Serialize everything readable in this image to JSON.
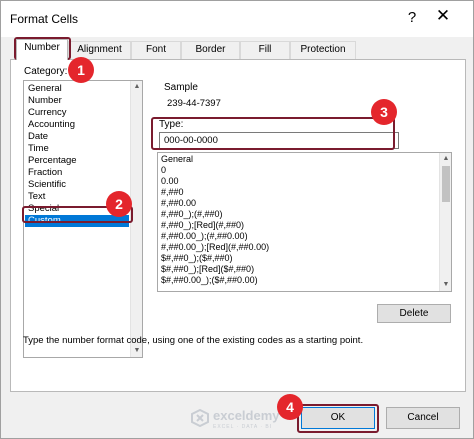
{
  "window": {
    "title": "Format Cells",
    "help_glyph": "?",
    "close_glyph": "✕"
  },
  "tabs": [
    {
      "label": "Number",
      "active": true
    },
    {
      "label": "Alignment"
    },
    {
      "label": "Font"
    },
    {
      "label": "Border"
    },
    {
      "label": "Fill"
    },
    {
      "label": "Protection"
    }
  ],
  "category": {
    "label": "Category:",
    "items": [
      "General",
      "Number",
      "Currency",
      "Accounting",
      "Date",
      "Time",
      "Percentage",
      "Fraction",
      "Scientific",
      "Text",
      "Special",
      "Custom"
    ],
    "selected": "Custom"
  },
  "sample": {
    "label": "Sample",
    "value": "239-44-7397"
  },
  "type": {
    "label": "Type:",
    "value": "000-00-0000",
    "formats": [
      "General",
      "0",
      "0.00",
      "#,##0",
      "#,##0.00",
      "#,##0_);(#,##0)",
      "#,##0_);[Red](#,##0)",
      "#,##0.00_);(#,##0.00)",
      "#,##0.00_);[Red](#,##0.00)",
      "$#,##0_);($#,##0)",
      "$#,##0_);[Red]($#,##0)",
      "$#,##0.00_);($#,##0.00)"
    ]
  },
  "buttons": {
    "delete": "Delete",
    "ok": "OK",
    "cancel": "Cancel"
  },
  "description": "Type the number format code, using one of the existing codes as a starting point.",
  "annotations": {
    "step1": "1",
    "step2": "2",
    "step3": "3",
    "step4": "4",
    "color": "#e4262c"
  },
  "watermark": {
    "name": "exceldemy",
    "tagline": "EXCEL · DATA · BI"
  }
}
